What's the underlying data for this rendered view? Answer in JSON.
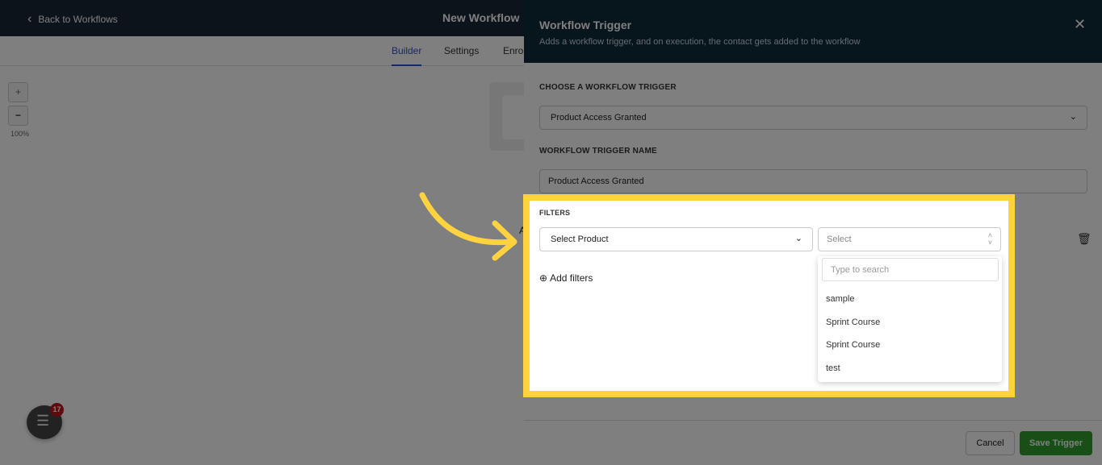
{
  "topbar": {
    "back_label": "Back to Workflows",
    "title": "New Workflow"
  },
  "tabs": [
    {
      "label": "Builder",
      "active": true
    },
    {
      "label": "Settings"
    },
    {
      "label": "Enro"
    }
  ],
  "zoom": {
    "plus": "+",
    "minus": "−",
    "level": "100%"
  },
  "canvas": {
    "partial_text": "A"
  },
  "panel": {
    "title": "Workflow Trigger",
    "subtitle": "Adds a workflow trigger, and on execution, the contact gets added to the workflow",
    "trigger_label": "CHOOSE A WORKFLOW TRIGGER",
    "trigger_value": "Product Access Granted",
    "name_label": "WORKFLOW TRIGGER NAME",
    "name_value": "Product Access Granted",
    "filters_label": "FILTERS",
    "filter_field": "Select Product",
    "filter_value_placeholder": "Select",
    "search_placeholder": "Type to search",
    "options": [
      "sample",
      "Sprint Course",
      "Sprint Course",
      "test"
    ],
    "add_filters": "Add filters",
    "cancel": "Cancel",
    "save": "Save Trigger"
  },
  "chat": {
    "badge": "17"
  },
  "colors": {
    "highlight": "#ffd23f",
    "save": "#2e9e2e",
    "header": "#0e2a3b"
  }
}
